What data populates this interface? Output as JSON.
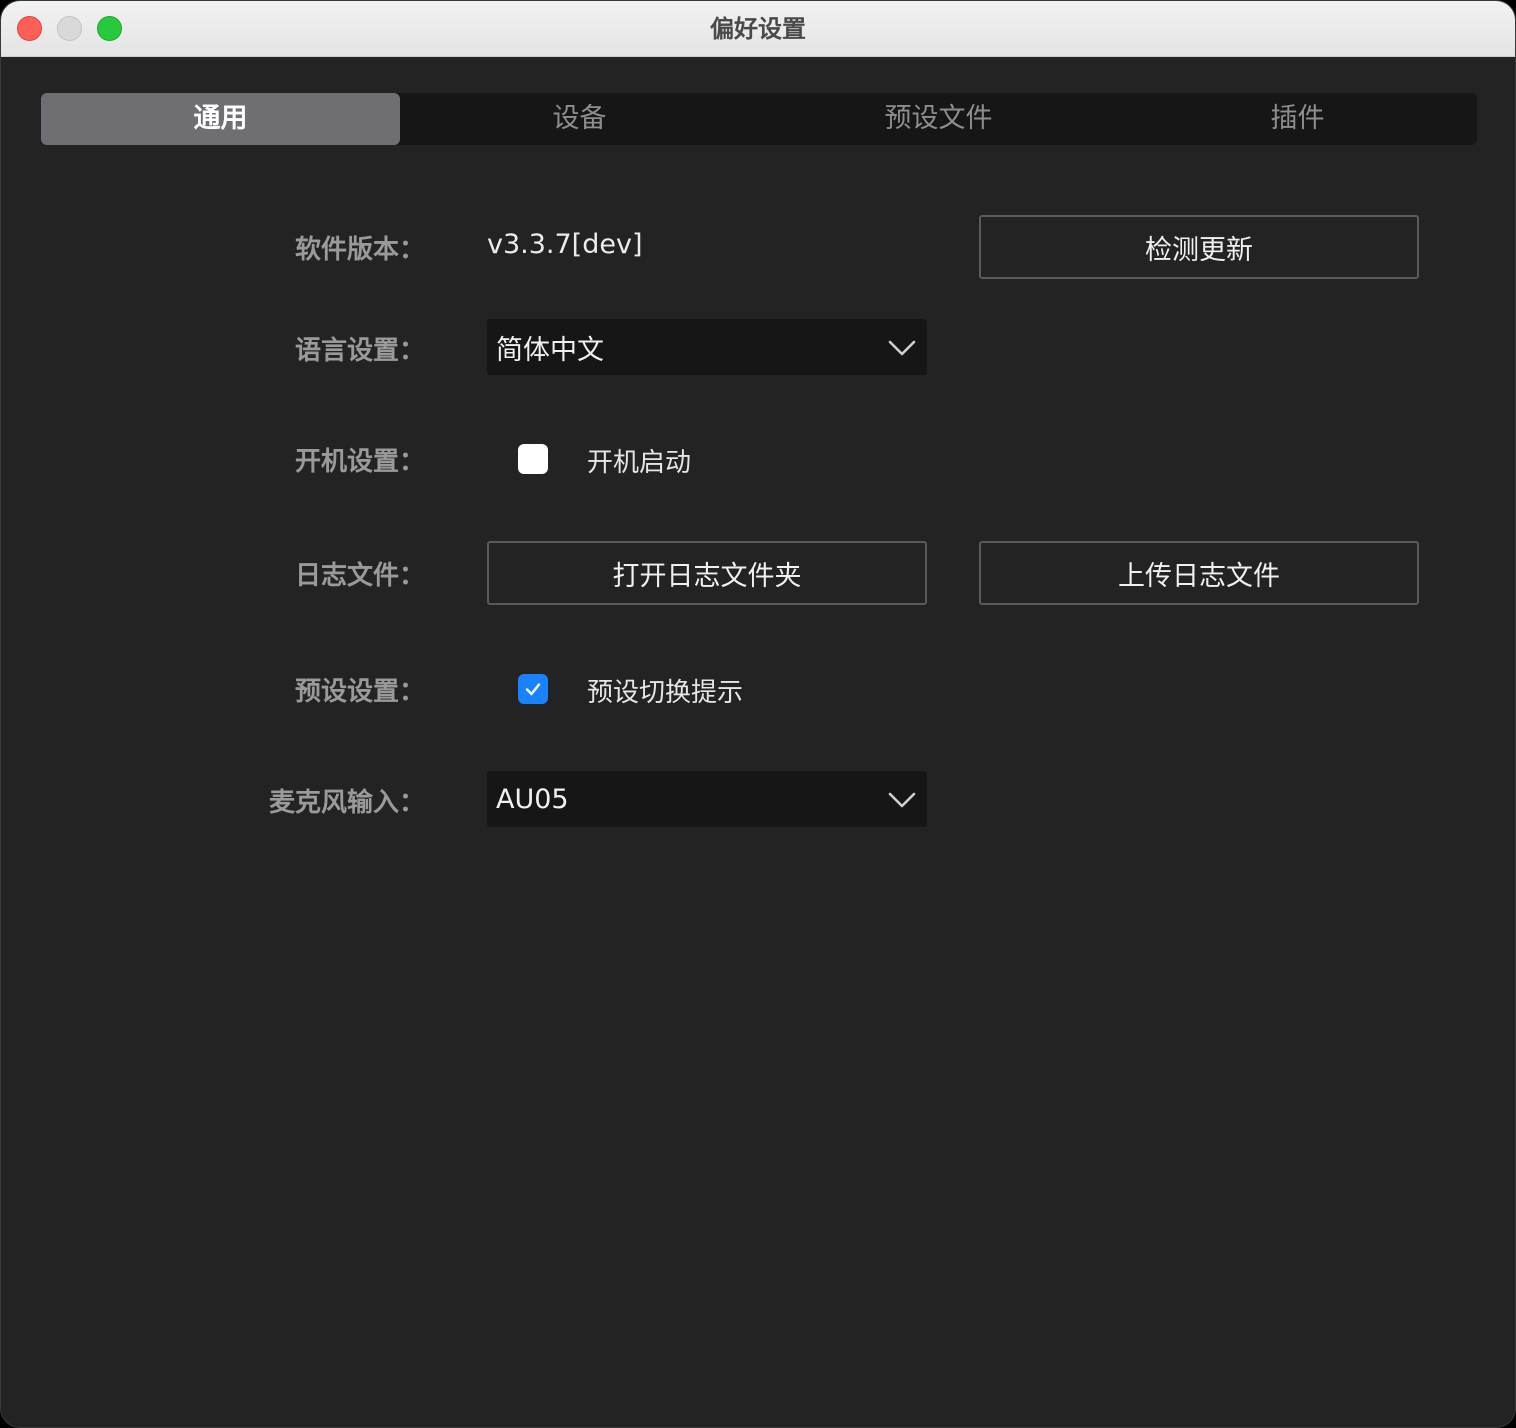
{
  "window": {
    "title": "偏好设置"
  },
  "tabs": [
    {
      "label": "通用",
      "active": true
    },
    {
      "label": "设备",
      "active": false
    },
    {
      "label": "预设文件",
      "active": false
    },
    {
      "label": "插件",
      "active": false
    }
  ],
  "general": {
    "version": {
      "label": "软件版本：",
      "value": "v3.3.7[dev]",
      "check_update_label": "检测更新"
    },
    "language": {
      "label": "语言设置：",
      "selected": "简体中文"
    },
    "startup": {
      "label": "开机设置：",
      "checkbox_label": "开机启动",
      "checked": false
    },
    "log": {
      "label": "日志文件：",
      "open_folder_label": "打开日志文件夹",
      "upload_label": "上传日志文件"
    },
    "preset": {
      "label": "预设设置：",
      "checkbox_label": "预设切换提示",
      "checked": true
    },
    "microphone": {
      "label": "麦克风输入：",
      "selected": "AU05"
    }
  },
  "colors": {
    "window_bg": "#232323",
    "active_tab": "#6f6f73",
    "checkbox_accent": "#1a82ff",
    "close": "#ff5f57",
    "maximize": "#28c840"
  }
}
